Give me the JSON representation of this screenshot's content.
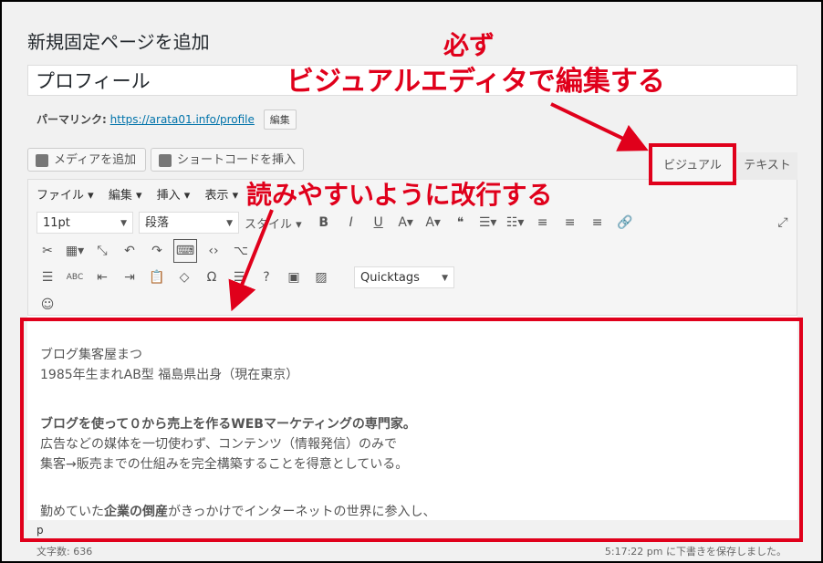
{
  "page": {
    "title": "新規固定ページを追加"
  },
  "post": {
    "title_value": "プロフィール",
    "permalink_label": "パーマリンク:",
    "permalink_url": "https://arata01.info/profile",
    "edit_label": "編集"
  },
  "media": {
    "add_media_label": "メディアを追加",
    "shortcode_label": "ショートコードを挿入"
  },
  "tabs": {
    "visual": "ビジュアル",
    "text": "テキスト"
  },
  "menubar": {
    "items": [
      "ファイル ▾",
      "編集 ▾",
      "挿入 ▾",
      "表示 ▾"
    ]
  },
  "toolbar": {
    "font_size": "11pt",
    "paragraph": "段落",
    "style": "スタイル ▾",
    "quicktags": "Quicktags"
  },
  "content": {
    "lines": [
      "ブログ集客屋まつ",
      "1985年生まれAB型 福島県出身（現在東京）",
      "",
      "ブログを使って０から売上を作るWEBマーケティングの専門家。",
      "広告などの媒体を一切使わず、コンテンツ（情報発信）のみで",
      "集客→販売までの仕組みを完全構築することを得意としている。",
      "",
      "勤めていた企業の倒産がきっかけでインターネットの世界に参入し、"
    ],
    "bold_line_index": 3,
    "last_line_pre": "勤めていた",
    "last_line_bold": "企業の倒産",
    "last_line_post": "がきっかけでインターネットの世界に参入し、"
  },
  "status": {
    "path": "p",
    "word_count": "文字数: 636",
    "save_status": "5:17:22 pm に下書きを保存しました。"
  },
  "annotations": {
    "must": "必ず",
    "visual_editor": "ビジュアルエディタで編集する",
    "newline": "読みやすいように改行する"
  },
  "colors": {
    "annotation_red": "#e0001b",
    "link_blue": "#0073aa"
  }
}
